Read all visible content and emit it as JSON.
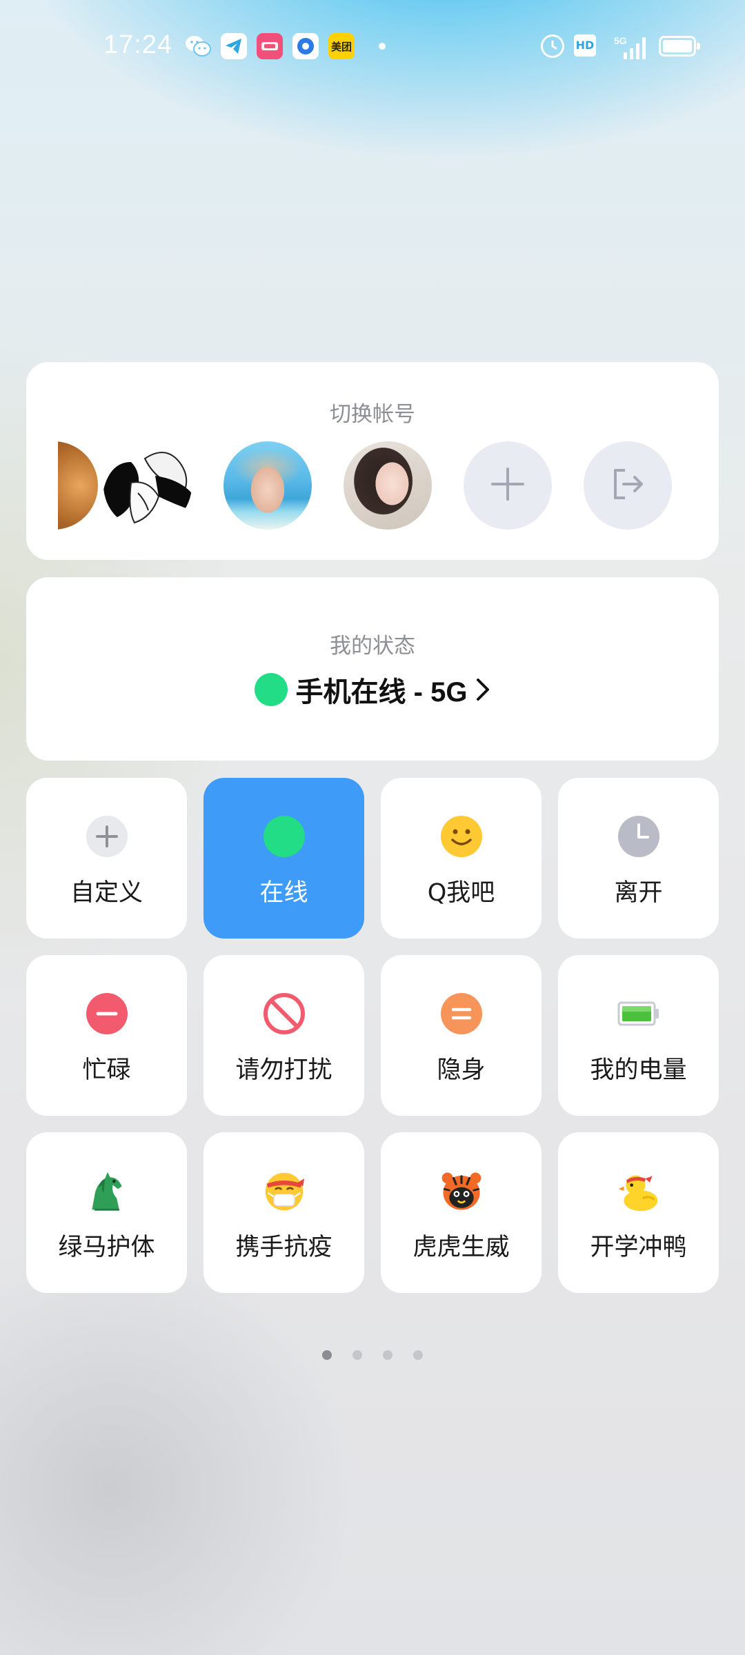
{
  "status_bar": {
    "time": "17:24",
    "notifications": [
      "wechat-icon",
      "telegram-icon",
      "app-icon",
      "app-icon",
      "meituan-icon"
    ],
    "meituan_label": "美团",
    "hd_label": "HD",
    "network": "5G",
    "battery_icon": "battery-icon"
  },
  "account_switcher": {
    "title": "切换帐号",
    "add_icon": "plus-icon",
    "logout_icon": "logout-icon"
  },
  "my_status": {
    "title": "我的状态",
    "current": "手机在线 - 5G",
    "dot_color": "#22dc86"
  },
  "status_options": [
    {
      "label": "自定义",
      "icon": "plus-icon"
    },
    {
      "label": "在线",
      "icon": "online-dot-icon",
      "selected": true
    },
    {
      "label": "Q我吧",
      "icon": "smile-icon"
    },
    {
      "label": "离开",
      "icon": "clock-icon"
    },
    {
      "label": "忙碌",
      "icon": "minus-circle-icon"
    },
    {
      "label": "请勿打扰",
      "icon": "no-entry-icon"
    },
    {
      "label": "隐身",
      "icon": "equals-circle-icon"
    },
    {
      "label": "我的电量",
      "icon": "battery-icon"
    },
    {
      "label": "绿马护体",
      "icon": "green-horse-icon"
    },
    {
      "label": "携手抗疫",
      "icon": "mask-face-icon"
    },
    {
      "label": "虎虎生威",
      "icon": "tiger-icon"
    },
    {
      "label": "开学冲鸭",
      "icon": "duck-icon"
    }
  ],
  "pagination": {
    "pages": 4,
    "current": 1
  },
  "colors": {
    "accent": "#3f9bf8",
    "online": "#22dc86",
    "busy": "#f25a6e",
    "invisible": "#f7945a",
    "away": "#b9bcc6",
    "smile": "#ffc933"
  }
}
